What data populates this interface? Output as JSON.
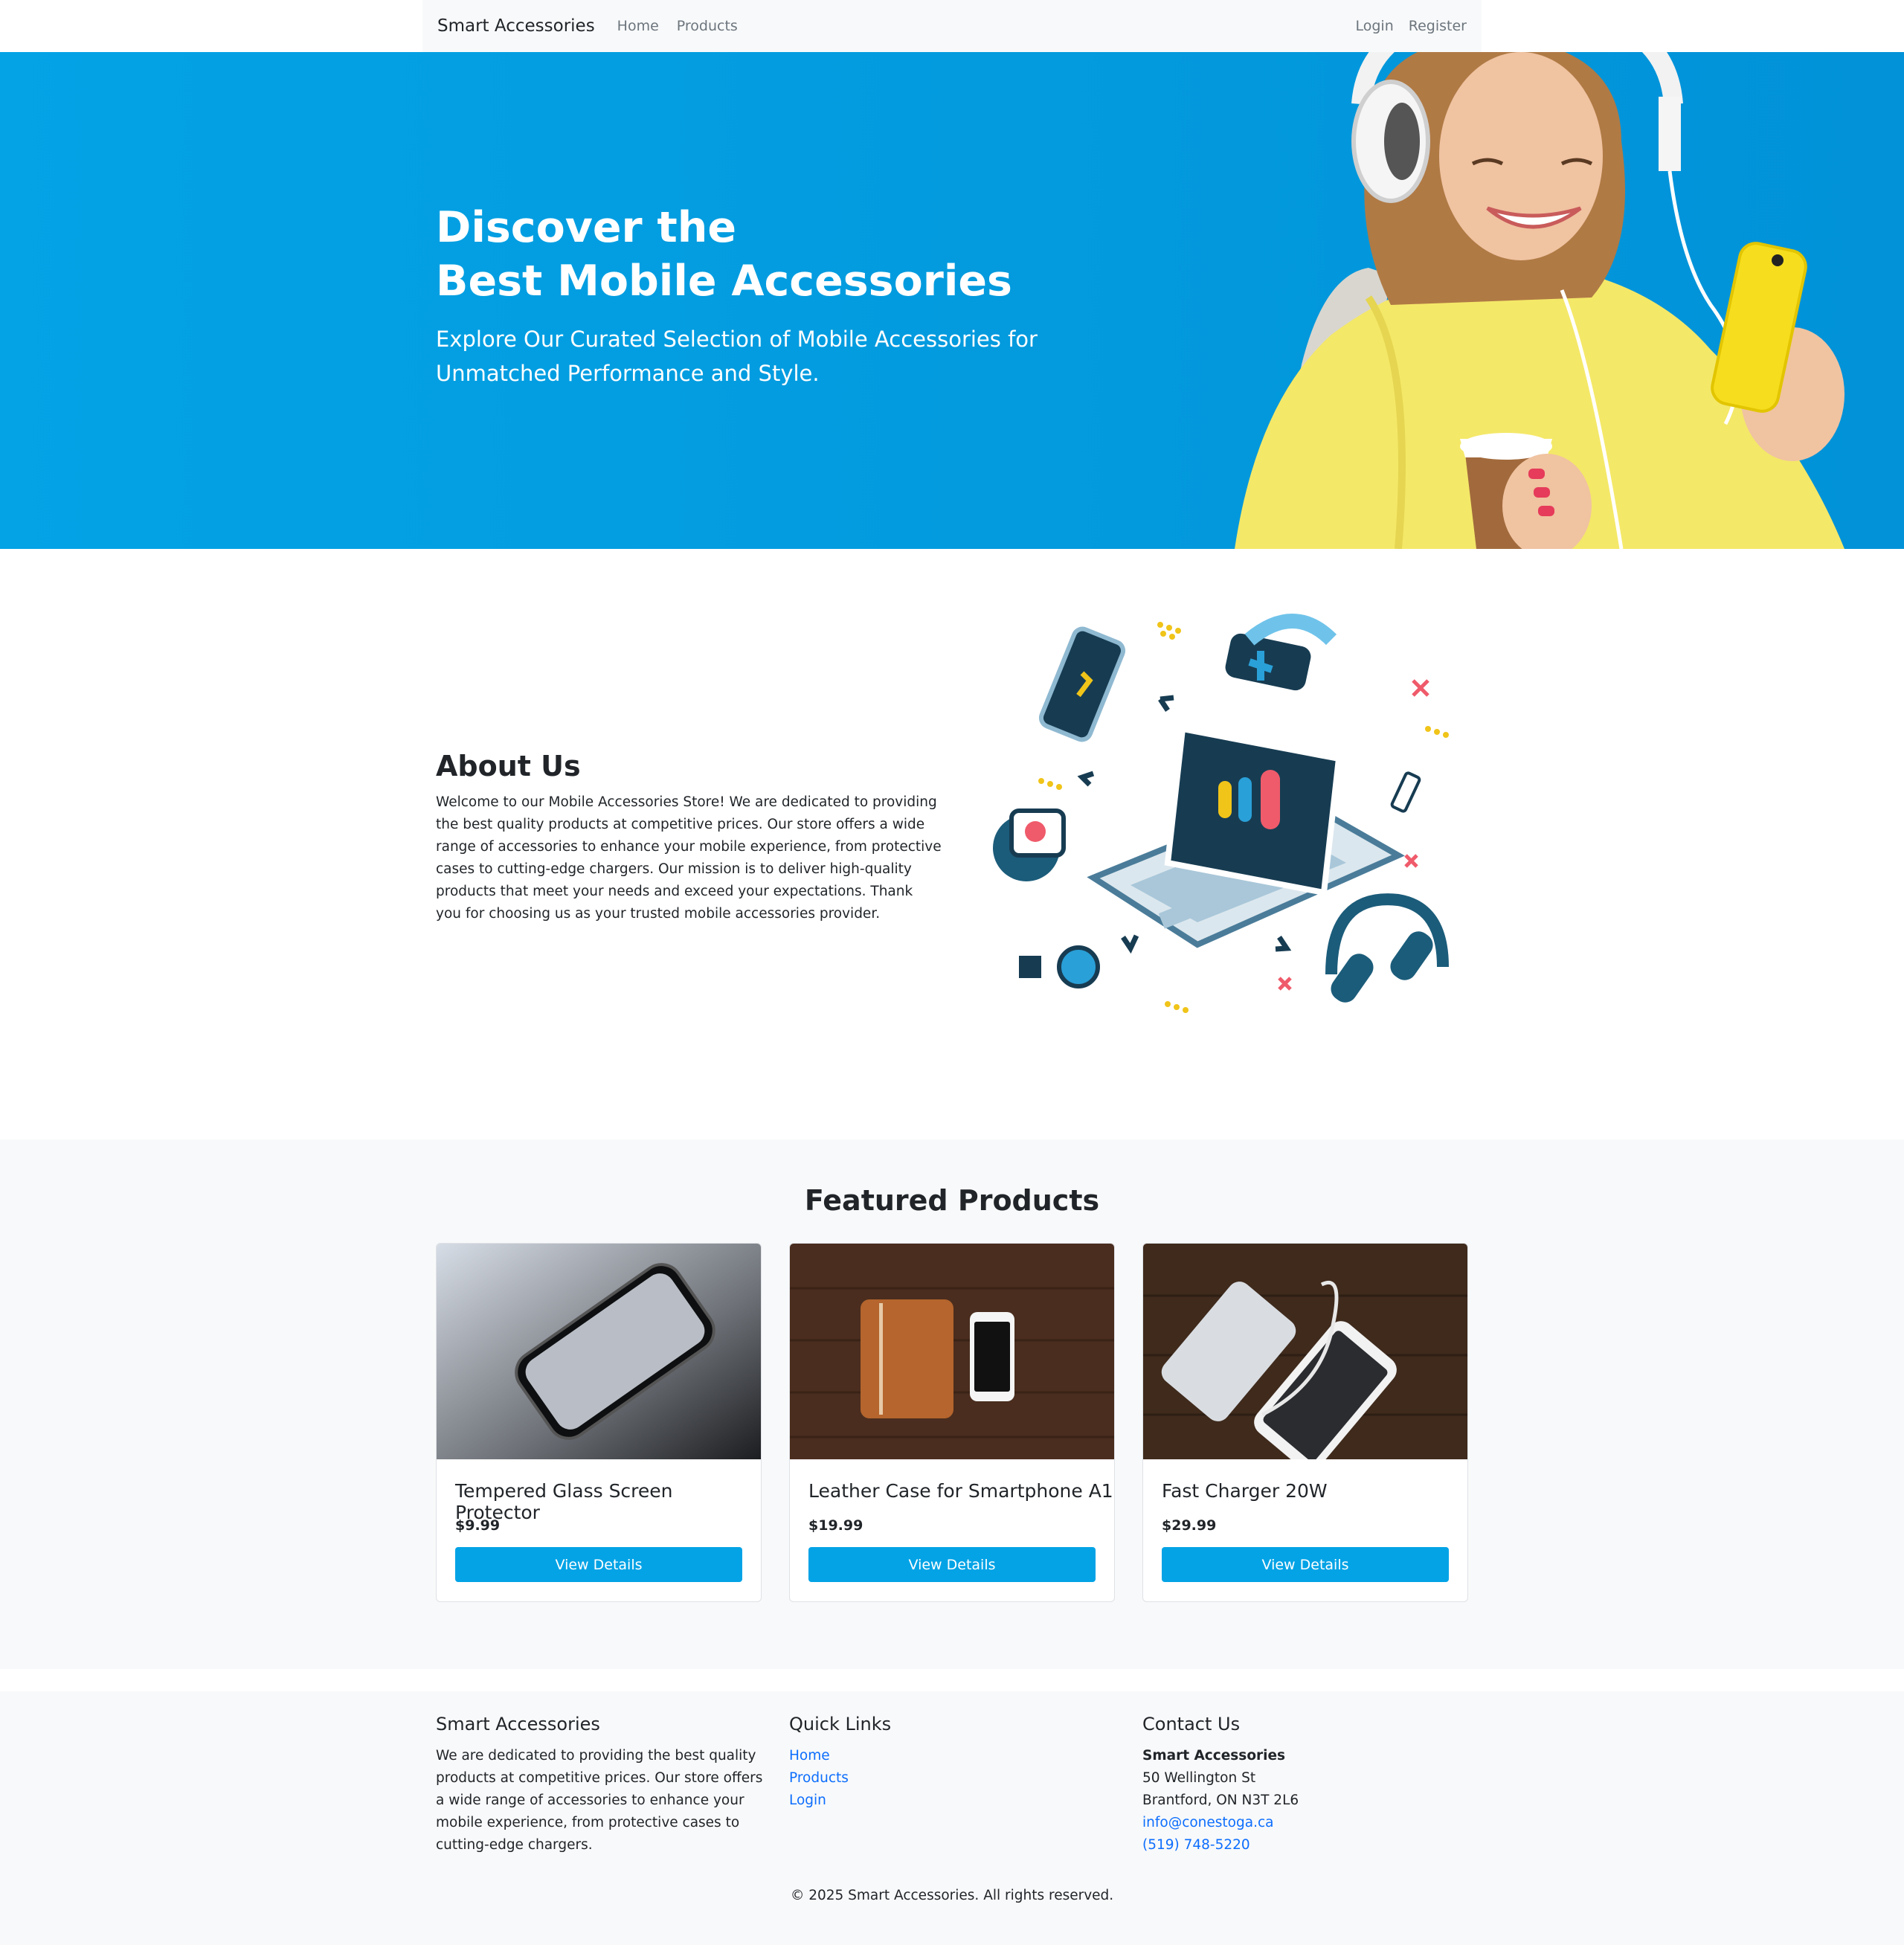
{
  "navbar": {
    "brand": "Smart Accessories",
    "links": [
      "Home",
      "Products"
    ],
    "right_links": [
      "Login",
      "Register"
    ]
  },
  "hero": {
    "title_line1": "Discover the",
    "title_line2": "Best Mobile Accessories",
    "subtitle_line1": "Explore Our Curated Selection of Mobile Accessories for",
    "subtitle_line2": "Unmatched Performance and Style."
  },
  "about": {
    "title": "About Us",
    "text": "Welcome to our Mobile Accessories Store! We are dedicated to providing the best quality products at competitive prices. Our store offers a wide range of accessories to enhance your mobile experience, from protective cases to cutting-edge chargers. Our mission is to deliver high-quality products that meet your needs and exceed your expectations. Thank you for choosing us as your trusted mobile accessories provider."
  },
  "featured": {
    "title": "Featured Products",
    "products": [
      {
        "name": "Tempered Glass Screen Protector",
        "price": "$9.99",
        "button": "View Details"
      },
      {
        "name": "Leather Case for Smartphone A1",
        "price": "$19.99",
        "button": "View Details"
      },
      {
        "name": "Fast Charger 20W",
        "price": "$29.99",
        "button": "View Details"
      }
    ]
  },
  "footer": {
    "about_title": "Smart Accessories",
    "about_text": "We are dedicated to providing the best quality products at competitive prices. Our store offers a wide range of accessories to enhance your mobile experience, from protective cases to cutting-edge chargers.",
    "links_title": "Quick Links",
    "links": [
      "Home",
      "Products",
      "Login"
    ],
    "contact_title": "Contact Us",
    "contact_name": "Smart Accessories",
    "contact_street": "50 Wellington St",
    "contact_city": "Brantford, ON N3T 2L6",
    "contact_email": "info@conestoga.ca",
    "contact_phone": "(519) 748-5220",
    "copyright": "© 2025 Smart Accessories. All rights reserved."
  },
  "colors": {
    "accent": "#03a3e6",
    "link": "#0d6efd",
    "light_bg": "#f8f9fa"
  }
}
